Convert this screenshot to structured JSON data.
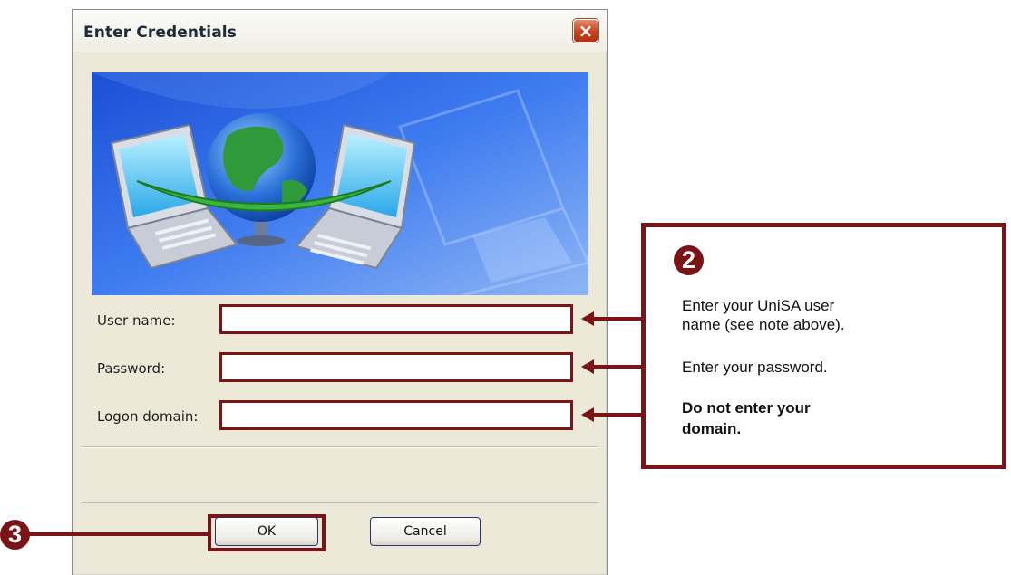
{
  "dialog": {
    "title": "Enter Credentials",
    "close_glyph": "×",
    "fields": {
      "username": {
        "label": "User name:",
        "value": ""
      },
      "password": {
        "label": "Password:",
        "value": ""
      },
      "domain": {
        "label": "Logon domain:",
        "value": ""
      }
    },
    "buttons": {
      "ok": "OK",
      "cancel": "Cancel"
    }
  },
  "callout": {
    "step": "2",
    "lines": [
      "Enter your UniSA user",
      "name (see note above).",
      "Enter your password.",
      "Do not enter your",
      "domain."
    ]
  },
  "step3": {
    "badge": "3"
  },
  "colors": {
    "annotation": "#7a1416",
    "dialog_bg": "#ece9d8"
  }
}
